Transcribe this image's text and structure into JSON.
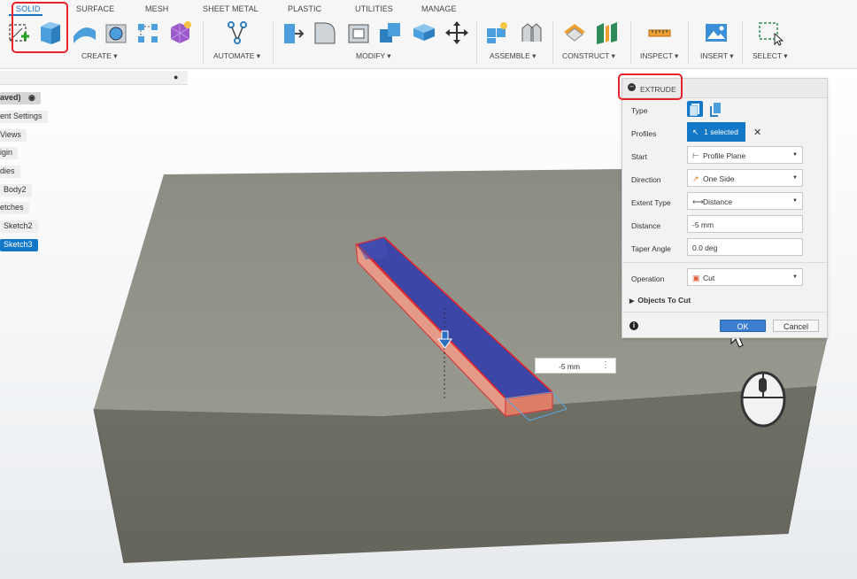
{
  "toolbar": {
    "tabs": [
      {
        "label": "SOLID",
        "active": true
      },
      {
        "label": "SURFACE"
      },
      {
        "label": "MESH"
      },
      {
        "label": "SHEET METAL"
      },
      {
        "label": "PLASTIC"
      },
      {
        "label": "UTILITIES"
      },
      {
        "label": "MANAGE"
      }
    ],
    "groups": {
      "create": "CREATE ▾",
      "automate": "AUTOMATE ▾",
      "modify": "MODIFY ▾",
      "assemble": "ASSEMBLE ▾",
      "construct": "CONSTRUCT ▾",
      "inspect": "INSPECT ▾",
      "insert": "INSERT ▾",
      "select": "SELECT ▾"
    }
  },
  "browser": {
    "items": [
      {
        "label": "aved)"
      },
      {
        "label": "ent Settings"
      },
      {
        "label": "Views"
      },
      {
        "label": "igin"
      },
      {
        "label": "dies"
      },
      {
        "label": "Body2"
      },
      {
        "label": "etches"
      },
      {
        "label": "Sketch2"
      },
      {
        "label": "Sketch3",
        "selected": true
      }
    ]
  },
  "dialog": {
    "title": "EXTRUDE",
    "rows": {
      "type": "Type",
      "profiles": "Profiles",
      "profiles_value": "1 selected",
      "start": "Start",
      "start_value": "Profile Plane",
      "direction": "Direction",
      "direction_value": "One Side",
      "extent_type": "Extent Type",
      "extent_value": "Distance",
      "distance": "Distance",
      "distance_value": "-5 mm",
      "taper_angle": "Taper Angle",
      "taper_value": "0.0 deg",
      "operation": "Operation",
      "operation_value": "Cut",
      "objects_to_cut": "Objects To Cut"
    },
    "ok_label": "OK",
    "cancel_label": "Cancel"
  },
  "canvas": {
    "dimension_value": "-5 mm"
  },
  "colors": {
    "accent": "#1478c8",
    "highlight": "#e8232a",
    "body_top": "#8e8f87",
    "body_front": "#727268",
    "cut_fill": "#3a46a8",
    "cut_wall": "#e89c8c"
  }
}
